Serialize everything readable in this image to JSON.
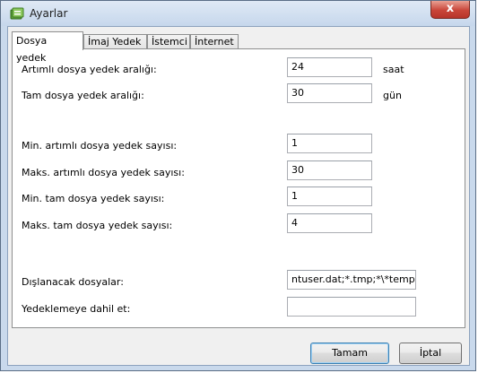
{
  "window": {
    "title": "Ayarlar",
    "close_symbol": "x"
  },
  "tabs": [
    {
      "label": "Dosya yedek",
      "active": true
    },
    {
      "label": "İmaj Yedek",
      "active": false
    },
    {
      "label": "İstemci",
      "active": false
    },
    {
      "label": "İnternet",
      "active": false
    }
  ],
  "form": {
    "incremental_interval": {
      "label": "Artımlı dosya yedek aralığı:",
      "value": "24",
      "unit": "saat"
    },
    "full_interval": {
      "label": "Tam dosya yedek aralığı:",
      "value": "30",
      "unit": "gün"
    },
    "min_incremental": {
      "label": "Min. artımlı dosya yedek sayısı:",
      "value": "1"
    },
    "max_incremental": {
      "label": "Maks. artımlı dosya yedek sayısı:",
      "value": "30"
    },
    "min_full": {
      "label": "Min. tam dosya yedek sayısı:",
      "value": "1"
    },
    "max_full": {
      "label": "Maks. tam dosya yedek sayısı:",
      "value": "4"
    },
    "excluded_files": {
      "label": "Dışlanacak dosyalar:",
      "value": "ntuser.dat;*.tmp;*\\*temp*\\"
    },
    "include_in_backup": {
      "label": "Yedeklemeye dahil et:",
      "value": ""
    }
  },
  "buttons": {
    "ok": "Tamam",
    "cancel": "İptal"
  },
  "icons": {
    "app": "settings-app-icon",
    "close": "close-icon"
  },
  "colors": {
    "frame": "#c9d9ec",
    "close_button": "#c9463a"
  }
}
